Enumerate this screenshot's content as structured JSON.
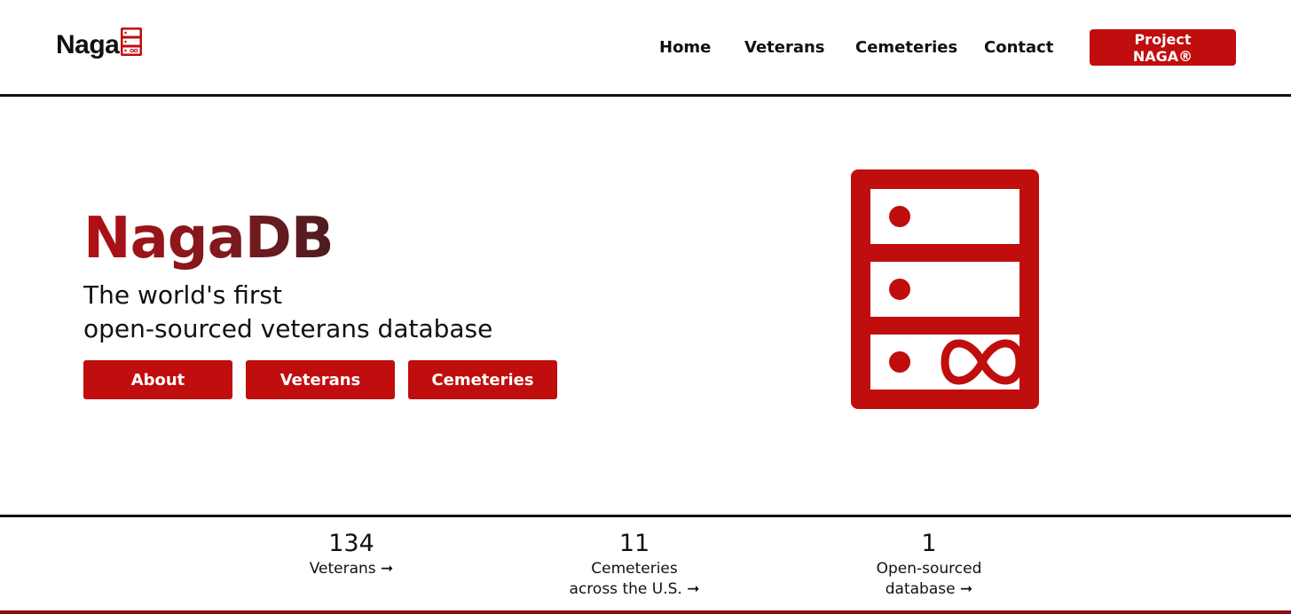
{
  "header": {
    "logo_text": "Naga",
    "logo_icon": "server-infinity-icon",
    "nav": {
      "home": "Home",
      "veterans": "Veterans",
      "cemeteries": "Cemeteries",
      "contact": "Contact",
      "project": "Project NAGA®"
    }
  },
  "hero": {
    "title": "NagaDB",
    "subtitle_line1": "The world's first",
    "subtitle_line2": "open-sourced veterans database",
    "buttons": {
      "about": "About",
      "veterans": "Veterans",
      "cemeteries": "Cemeteries"
    },
    "illustration_icon": "server-rack-infinity-icon"
  },
  "stats": [
    {
      "number": "134",
      "label_line1": "Veterans ➞",
      "label_line2": ""
    },
    {
      "number": "11",
      "label_line1": "Cemeteries",
      "label_line2": "across the U.S. ➞"
    },
    {
      "number": "1",
      "label_line1": "Open-sourced",
      "label_line2": "database ➞"
    }
  ],
  "colors": {
    "accent": "#c00d0d",
    "title_gradient_start": "#b20f14",
    "title_gradient_end": "#4a1c20",
    "text": "#111111"
  }
}
